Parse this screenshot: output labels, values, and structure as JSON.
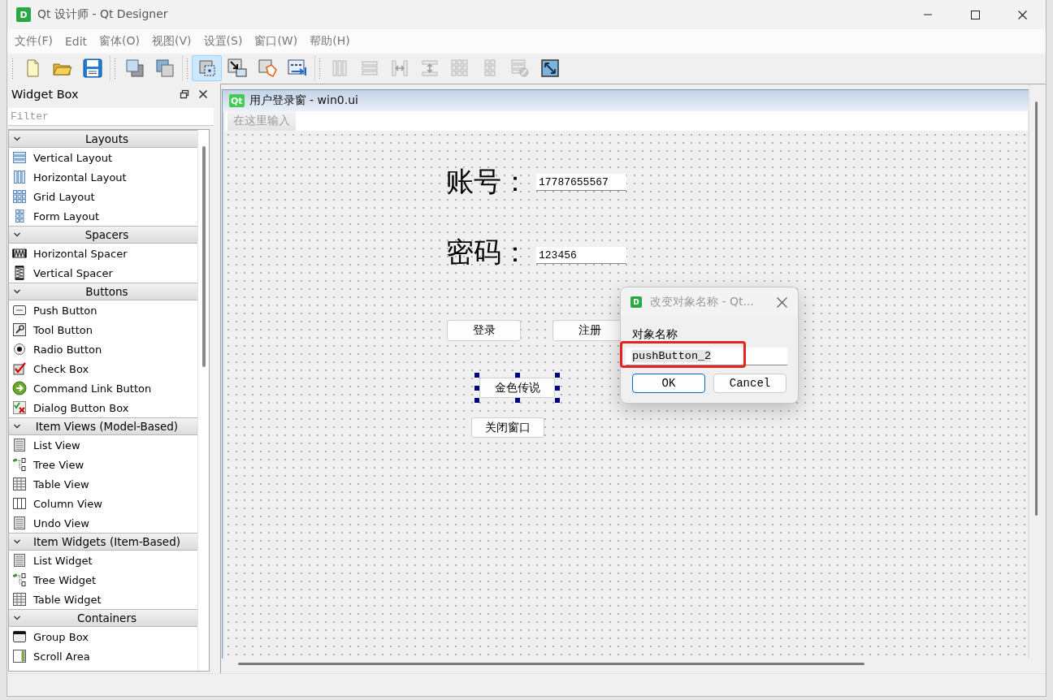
{
  "window": {
    "logo": "D",
    "title": "Qt 设计师 - Qt Designer"
  },
  "menu": [
    "文件(F)",
    "Edit",
    "窗体(O)",
    "视图(V)",
    "设置(S)",
    "窗口(W)",
    "帮助(H)"
  ],
  "toolbar": [
    [
      {
        "kind": "new",
        "selected": false,
        "disabled": false
      },
      {
        "kind": "open",
        "selected": false,
        "disabled": false
      },
      {
        "kind": "save",
        "selected": false,
        "disabled": false
      }
    ],
    [
      {
        "kind": "raise",
        "selected": false,
        "disabled": false
      },
      {
        "kind": "lower",
        "selected": false,
        "disabled": false
      }
    ],
    [
      {
        "kind": "edit-widgets",
        "selected": true,
        "disabled": false
      },
      {
        "kind": "signals-slots",
        "selected": false,
        "disabled": false
      },
      {
        "kind": "buddies",
        "selected": false,
        "disabled": false
      },
      {
        "kind": "tab-order",
        "selected": false,
        "disabled": false
      }
    ],
    [
      {
        "kind": "layout-horizontal",
        "selected": false,
        "disabled": true
      },
      {
        "kind": "layout-vertical",
        "selected": false,
        "disabled": true
      },
      {
        "kind": "splitter-horizontal",
        "selected": false,
        "disabled": true
      },
      {
        "kind": "splitter-vertical",
        "selected": false,
        "disabled": true
      },
      {
        "kind": "layout-grid",
        "selected": false,
        "disabled": true
      },
      {
        "kind": "layout-form",
        "selected": false,
        "disabled": true
      },
      {
        "kind": "break-layout",
        "selected": false,
        "disabled": true
      },
      {
        "kind": "adjust-size",
        "selected": false,
        "disabled": false
      }
    ]
  ],
  "widget_box": {
    "title": "Widget Box",
    "filter": {
      "placeholder": "Filter"
    },
    "categories": [
      {
        "label": "Layouts",
        "expanded": true,
        "items": [
          {
            "label": "Vertical Layout",
            "kind": "vertical-layout"
          },
          {
            "label": "Horizontal Layout",
            "kind": "horizontal-layout"
          },
          {
            "label": "Grid Layout",
            "kind": "grid-layout"
          },
          {
            "label": "Form Layout",
            "kind": "form-layout"
          }
        ]
      },
      {
        "label": "Spacers",
        "expanded": true,
        "items": [
          {
            "label": "Horizontal Spacer",
            "kind": "horizontal-spacer"
          },
          {
            "label": "Vertical Spacer",
            "kind": "vertical-spacer"
          }
        ]
      },
      {
        "label": "Buttons",
        "expanded": true,
        "items": [
          {
            "label": "Push Button",
            "kind": "push-button"
          },
          {
            "label": "Tool Button",
            "kind": "tool-button"
          },
          {
            "label": "Radio Button",
            "kind": "radio-button"
          },
          {
            "label": "Check Box",
            "kind": "check-box"
          },
          {
            "label": "Command Link Button",
            "kind": "command-link-button"
          },
          {
            "label": "Dialog Button Box",
            "kind": "dialog-button-box"
          }
        ]
      },
      {
        "label": "Item Views (Model-Based)",
        "expanded": true,
        "items": [
          {
            "label": "List View",
            "kind": "list-view"
          },
          {
            "label": "Tree View",
            "kind": "tree-view"
          },
          {
            "label": "Table View",
            "kind": "table-view"
          },
          {
            "label": "Column View",
            "kind": "column-view"
          },
          {
            "label": "Undo View",
            "kind": "undo-view"
          }
        ]
      },
      {
        "label": "Item Widgets (Item-Based)",
        "expanded": true,
        "items": [
          {
            "label": "List Widget",
            "kind": "list-widget"
          },
          {
            "label": "Tree Widget",
            "kind": "tree-widget"
          },
          {
            "label": "Table Widget",
            "kind": "table-widget"
          }
        ]
      },
      {
        "label": "Containers",
        "expanded": true,
        "items": [
          {
            "label": "Group Box",
            "kind": "group-box"
          },
          {
            "label": "Scroll Area",
            "kind": "scroll-area"
          }
        ]
      }
    ]
  },
  "form_window": {
    "logo": "Qt",
    "title": "用户登录窗 - win0.ui",
    "menu_placeholder": "在这里输入",
    "widgets": [
      {
        "kind": "label",
        "text": "账号：",
        "selected": false
      },
      {
        "kind": "line_edit",
        "value": "17787655567",
        "selected": false
      },
      {
        "kind": "label",
        "text": "密码：",
        "selected": false
      },
      {
        "kind": "line_edit",
        "value": "123456",
        "selected": false
      },
      {
        "kind": "button",
        "text": "登录",
        "selected": false
      },
      {
        "kind": "button",
        "text": "注册",
        "selected": false
      },
      {
        "kind": "button",
        "text": "金色传说",
        "selected": true
      },
      {
        "kind": "button",
        "text": "关闭窗口",
        "selected": false
      }
    ]
  },
  "dialog": {
    "logo": "D",
    "title": "改变对象名称 - Qt...",
    "field_label": "对象名称",
    "field_value": "pushButton_2",
    "value_selected": true,
    "highlighted": true,
    "buttons": [
      {
        "label": "OK",
        "default": true
      },
      {
        "label": "Cancel",
        "default": false
      }
    ]
  }
}
